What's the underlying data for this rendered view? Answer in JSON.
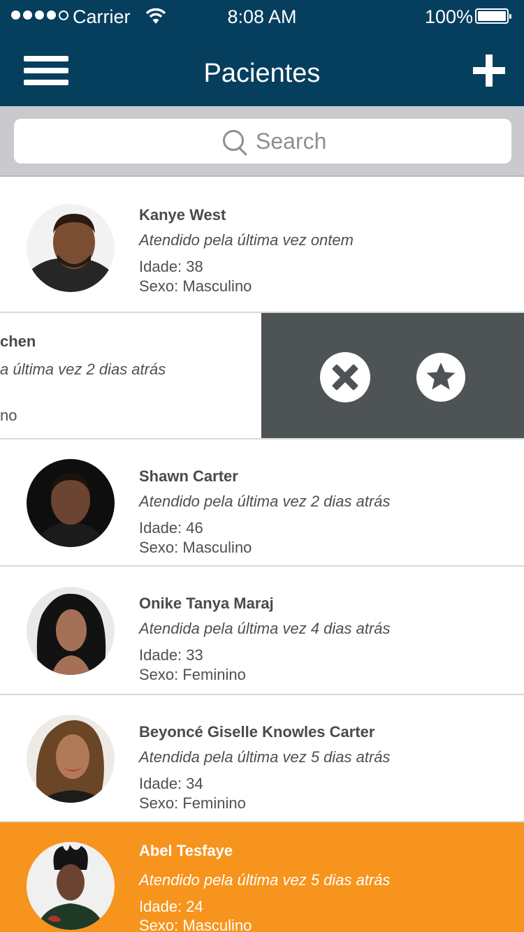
{
  "status_bar": {
    "carrier": "Carrier",
    "time": "8:08 AM",
    "battery": "100%"
  },
  "nav": {
    "title": "Pacientes"
  },
  "search": {
    "placeholder": "Search"
  },
  "patients": [
    {
      "name": "Kanye West",
      "last_visit": "Atendido pela última vez ontem",
      "age": "Idade: 38",
      "sex": "Sexo: Masculino"
    },
    {
      "name": "chen",
      "last_visit": "a última vez 2 dias atrás",
      "age": "",
      "sex": "no"
    },
    {
      "name": "Shawn Carter",
      "last_visit": "Atendido pela última vez 2 dias atrás",
      "age": "Idade: 46",
      "sex": "Sexo: Masculino"
    },
    {
      "name": "Onike Tanya Maraj",
      "last_visit": "Atendida pela última vez 4 dias atrás",
      "age": "Idade: 33",
      "sex": "Sexo: Feminino"
    },
    {
      "name": "Beyoncé Giselle Knowles Carter",
      "last_visit": "Atendida pela última vez 5 dias atrás",
      "age": "Idade: 34",
      "sex": "Sexo: Feminino"
    },
    {
      "name": "Abel Tesfaye",
      "last_visit": "Atendido pela última vez 5 dias atrás",
      "age": "Idade: 24",
      "sex": "Sexo: Masculino"
    }
  ],
  "colors": {
    "nav": "#063e5e",
    "highlight": "#f7941d",
    "swipe_actions": "#4e5356"
  },
  "icons": [
    "hamburger-menu-icon",
    "plus-icon",
    "search-icon",
    "close-icon",
    "star-icon",
    "wifi-icon",
    "battery-icon"
  ]
}
